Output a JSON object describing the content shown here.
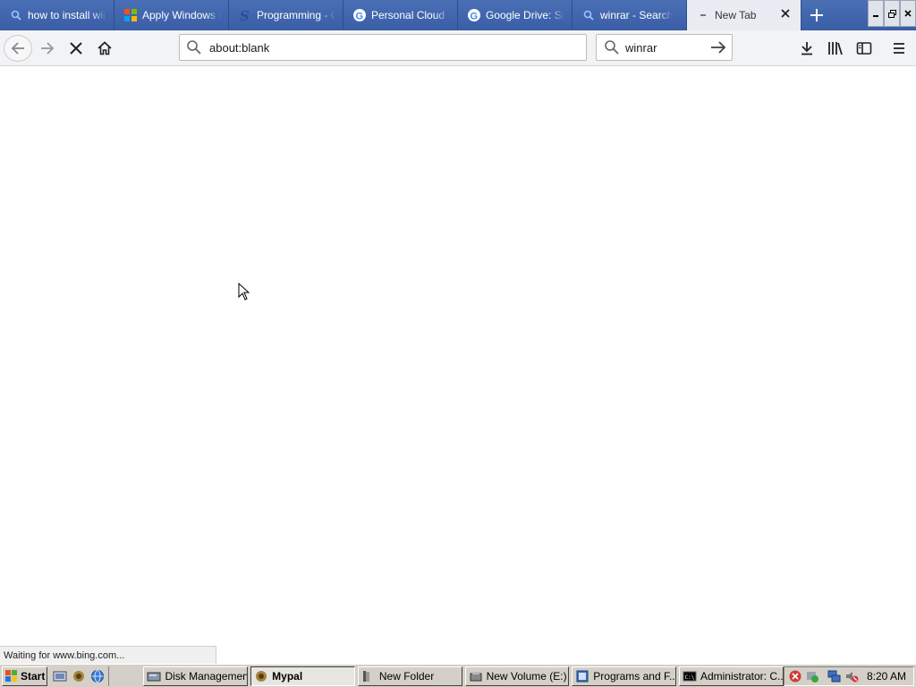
{
  "tabs": [
    {
      "label": "how to install winc",
      "icon": "search-icon",
      "active": false
    },
    {
      "label": "Apply Windows Im",
      "icon": "windows-logo-icon",
      "active": false
    },
    {
      "label": "Programming - Co",
      "icon": "s-logo-icon",
      "active": false
    },
    {
      "label": "Personal Cloud St",
      "icon": "google-icon",
      "active": false
    },
    {
      "label": "Google Drive: Sign",
      "icon": "google-icon",
      "active": false
    },
    {
      "label": "winrar - Search",
      "icon": "search-icon",
      "active": false
    },
    {
      "label": "New Tab",
      "icon": "loading-icon",
      "active": true
    }
  ],
  "navbar": {
    "url": "about:blank",
    "search_value": "winrar"
  },
  "status": {
    "text": "Waiting for www.bing.com..."
  },
  "taskbar": {
    "start_label": "Start",
    "tasks": [
      {
        "label": "Disk Management",
        "icon": "disk-management-icon",
        "active": false
      },
      {
        "label": "Mypal",
        "icon": "mypal-icon",
        "active": true
      },
      {
        "label": "New Folder",
        "icon": "folder-icon",
        "active": false
      },
      {
        "label": "New Volume (E:)",
        "icon": "drive-icon",
        "active": false
      },
      {
        "label": "Programs and F...",
        "icon": "programs-icon",
        "active": false
      },
      {
        "label": "Administrator: C...",
        "icon": "cmd-icon",
        "active": false
      }
    ],
    "clock": "8:20 AM"
  },
  "colors": {
    "tabstrip": "#3f63ab",
    "active_tab": "#e9ecf2",
    "taskbar": "#d4d0c8"
  }
}
